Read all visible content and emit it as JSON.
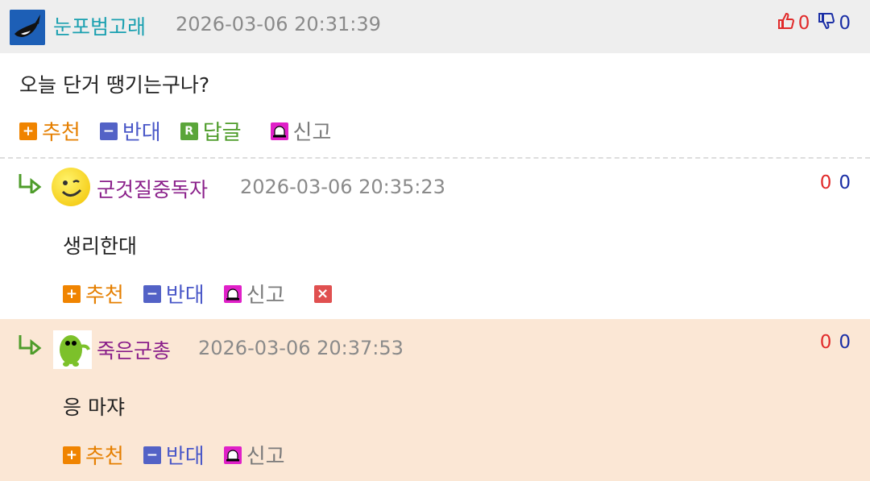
{
  "post": {
    "author": "눈포범고래",
    "date": "2026-03-06 20:31:39",
    "up_count": "0",
    "down_count": "0",
    "content": "오늘 단거 땡기는구나?",
    "actions": {
      "recommend": "추천",
      "oppose": "반대",
      "reply": "답글",
      "report": "신고"
    },
    "colors": {
      "author": "#1aa0b0"
    }
  },
  "comments": [
    {
      "author": "군것질중독자",
      "date": "2026-03-06 20:35:23",
      "up_count": "0",
      "down_count": "0",
      "content": "생리한대",
      "actions": {
        "recommend": "추천",
        "oppose": "반대",
        "report": "신고"
      },
      "icon": "smiley-avatar"
    },
    {
      "author": "죽은군총",
      "date": "2026-03-06 20:37:53",
      "up_count": "0",
      "down_count": "0",
      "content": "응 마쟈",
      "actions": {
        "recommend": "추천",
        "oppose": "반대",
        "report": "신고"
      },
      "icon": "green-creature-avatar"
    }
  ],
  "colors": {
    "comment_author": "#8a1f8a",
    "highlight_bg": "#fbe7d5"
  }
}
